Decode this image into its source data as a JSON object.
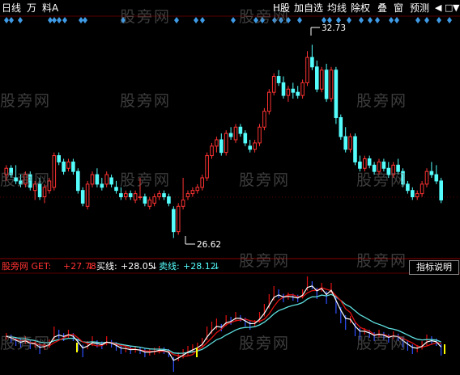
{
  "toolbar": {
    "left": [
      "日线",
      "万",
      "料A"
    ],
    "right": [
      "H股",
      "加自选",
      "均线",
      "除权",
      "叠",
      "窗",
      "预测"
    ]
  },
  "watermark": "股旁网",
  "colors": {
    "up": "#ff3232",
    "down": "#54fcfc",
    "diamond": "#3f9be6",
    "line_red": "#e01010",
    "line_cyan": "#5fe0e0",
    "line_blue": "#2f4fff",
    "line_white": "#ffffff",
    "line_yellow": "#ffff00"
  },
  "price_labels": {
    "high": "32.73",
    "low": "26.62"
  },
  "indicator": {
    "name": "股旁网 GET:",
    "value1": "+27.78",
    "arrow1": "↓",
    "label2": "买线:",
    "value2": "+28.05",
    "arrow2": "↓",
    "label3": "卖线:",
    "value3": "+28.12",
    "arrow3": "↓",
    "help_button": "指标说明"
  },
  "candles": [
    [
      28.6,
      28.9,
      28.4,
      28.8
    ],
    [
      28.8,
      28.9,
      28.5,
      28.6
    ],
    [
      28.5,
      28.9,
      28.3,
      28.4
    ],
    [
      28.4,
      28.6,
      28.2,
      28.3
    ],
    [
      28.3,
      28.7,
      28.2,
      28.6
    ],
    [
      28.6,
      28.7,
      28.1,
      28.2
    ],
    [
      28.1,
      28.4,
      27.8,
      28.3
    ],
    [
      28.3,
      28.5,
      27.8,
      27.9
    ],
    [
      27.9,
      28.3,
      27.7,
      28.2
    ],
    [
      28.1,
      28.5,
      28.0,
      28.4
    ],
    [
      28.2,
      29.3,
      28.1,
      29.2
    ],
    [
      29.2,
      29.3,
      28.9,
      29.0
    ],
    [
      29.0,
      29.1,
      28.6,
      28.7
    ],
    [
      28.8,
      29.1,
      28.7,
      29.0
    ],
    [
      29.0,
      29.1,
      28.6,
      28.7
    ],
    [
      28.7,
      28.8,
      28.0,
      28.1
    ],
    [
      28.1,
      28.2,
      27.6,
      27.7
    ],
    [
      27.6,
      28.4,
      27.5,
      28.3
    ],
    [
      28.3,
      28.7,
      28.2,
      28.6
    ],
    [
      28.6,
      28.8,
      28.2,
      28.3
    ],
    [
      28.3,
      28.5,
      28.1,
      28.2
    ],
    [
      28.3,
      28.7,
      28.2,
      28.6
    ],
    [
      28.5,
      28.6,
      28.2,
      28.3
    ],
    [
      28.2,
      28.4,
      28.0,
      28.1
    ],
    [
      28.0,
      28.2,
      27.8,
      27.9
    ],
    [
      27.9,
      28.1,
      27.8,
      28.0
    ],
    [
      28.0,
      28.1,
      27.8,
      27.9
    ],
    [
      27.8,
      28.1,
      27.7,
      28.0
    ],
    [
      27.9,
      28.5,
      27.8,
      27.9
    ],
    [
      27.9,
      28.0,
      27.6,
      27.7
    ],
    [
      27.6,
      27.9,
      27.5,
      27.8
    ],
    [
      27.7,
      28.0,
      27.6,
      27.9
    ],
    [
      27.9,
      28.1,
      27.8,
      28.0
    ],
    [
      28.0,
      28.1,
      27.8,
      27.9
    ],
    [
      27.9,
      28.0,
      27.6,
      27.7
    ],
    [
      27.5,
      27.6,
      26.6,
      26.8
    ],
    [
      26.8,
      27.7,
      26.7,
      27.6
    ],
    [
      27.6,
      28.5,
      27.5,
      27.8
    ],
    [
      27.9,
      28.1,
      27.8,
      28.0
    ],
    [
      28.0,
      28.2,
      27.9,
      28.1
    ],
    [
      28.1,
      28.3,
      28.0,
      28.2
    ],
    [
      28.2,
      28.6,
      28.1,
      28.5
    ],
    [
      28.5,
      29.3,
      28.4,
      29.2
    ],
    [
      29.2,
      29.6,
      29.1,
      29.5
    ],
    [
      29.5,
      29.8,
      29.3,
      29.7
    ],
    [
      29.7,
      29.9,
      29.2,
      29.3
    ],
    [
      29.3,
      30.0,
      29.2,
      29.9
    ],
    [
      29.9,
      30.1,
      29.7,
      29.8
    ],
    [
      29.7,
      30.2,
      29.6,
      30.1
    ],
    [
      30.1,
      30.2,
      29.8,
      29.9
    ],
    [
      29.9,
      30.0,
      29.5,
      29.6
    ],
    [
      29.5,
      29.7,
      29.3,
      29.4
    ],
    [
      29.4,
      29.7,
      29.3,
      29.6
    ],
    [
      29.6,
      30.2,
      29.5,
      30.1
    ],
    [
      30.1,
      30.7,
      30.0,
      30.6
    ],
    [
      30.6,
      31.3,
      30.5,
      31.2
    ],
    [
      31.2,
      31.8,
      31.1,
      31.7
    ],
    [
      31.7,
      31.9,
      31.4,
      31.5
    ],
    [
      31.5,
      31.7,
      31.0,
      31.1
    ],
    [
      31.1,
      31.4,
      30.9,
      31.3
    ],
    [
      31.3,
      31.5,
      31.0,
      31.2
    ],
    [
      31.2,
      31.4,
      31.0,
      31.1
    ],
    [
      31.1,
      31.6,
      31.0,
      31.5
    ],
    [
      31.5,
      32.5,
      31.4,
      32.3
    ],
    [
      32.3,
      32.7,
      31.9,
      32.0
    ],
    [
      32.0,
      32.2,
      31.2,
      31.3
    ],
    [
      31.3,
      32.0,
      31.2,
      31.9
    ],
    [
      31.9,
      32.1,
      30.9,
      31.0
    ],
    [
      31.0,
      32.0,
      30.9,
      31.9
    ],
    [
      31.9,
      32.0,
      30.2,
      30.4
    ],
    [
      30.4,
      30.5,
      29.7,
      29.8
    ],
    [
      29.8,
      30.1,
      29.3,
      29.4
    ],
    [
      29.4,
      29.9,
      29.3,
      29.8
    ],
    [
      29.8,
      29.9,
      28.9,
      29.0
    ],
    [
      29.0,
      29.2,
      28.7,
      28.8
    ],
    [
      28.8,
      29.2,
      28.7,
      29.1
    ],
    [
      29.1,
      29.2,
      28.8,
      28.9
    ],
    [
      28.9,
      29.0,
      28.6,
      28.7
    ],
    [
      28.7,
      29.1,
      28.6,
      29.0
    ],
    [
      29.0,
      29.1,
      28.7,
      28.8
    ],
    [
      28.8,
      29.0,
      28.5,
      28.6
    ],
    [
      28.6,
      29.0,
      28.5,
      28.9
    ],
    [
      28.9,
      29.1,
      28.6,
      28.7
    ],
    [
      28.7,
      28.8,
      28.2,
      28.3
    ],
    [
      28.3,
      28.4,
      28.0,
      28.1
    ],
    [
      28.1,
      28.2,
      27.8,
      27.9
    ],
    [
      27.9,
      28.1,
      27.8,
      28.0
    ],
    [
      28.0,
      28.4,
      27.9,
      28.3
    ],
    [
      28.3,
      28.8,
      28.2,
      28.7
    ],
    [
      28.7,
      29.0,
      28.5,
      28.6
    ],
    [
      28.6,
      28.9,
      28.3,
      28.4
    ],
    [
      28.4,
      28.5,
      27.7,
      27.8
    ]
  ]
}
